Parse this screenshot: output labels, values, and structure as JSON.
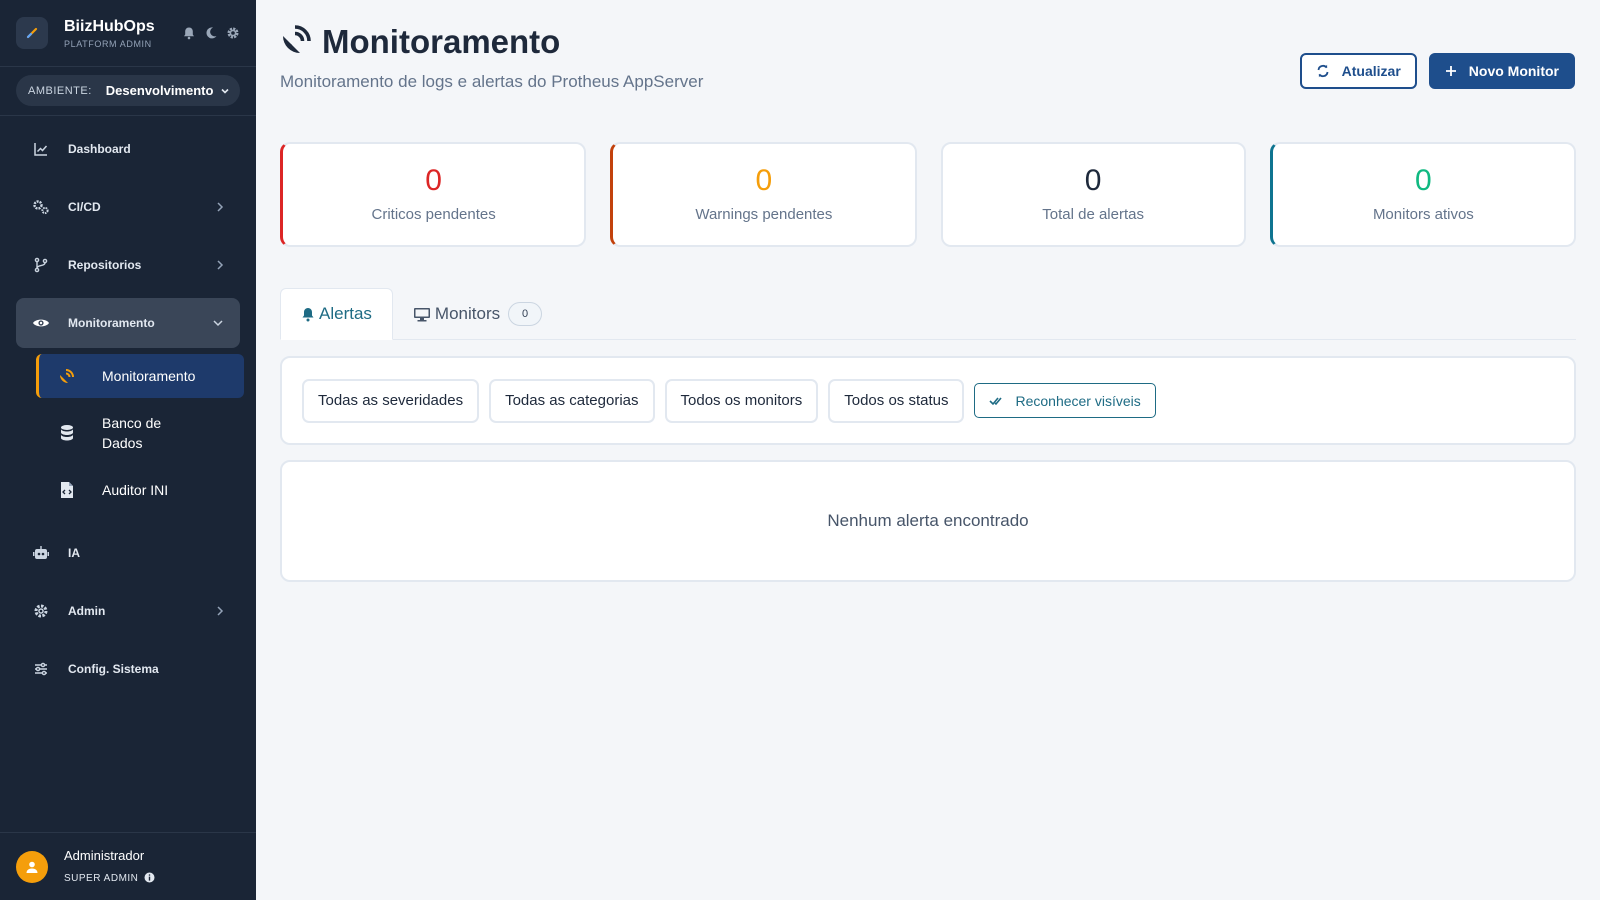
{
  "app": {
    "name": "BiizHubOps",
    "subtitle": "PLATFORM ADMIN"
  },
  "environment": {
    "label": "AMBIENTE:",
    "value": "Desenvolvimento"
  },
  "sidebar": {
    "items": [
      {
        "label": "Dashboard",
        "icon": "chart-line-icon"
      },
      {
        "label": "CI/CD",
        "icon": "cogs-icon"
      },
      {
        "label": "Repositorios",
        "icon": "branch-icon"
      },
      {
        "label": "Monitoramento",
        "icon": "eye-icon"
      },
      {
        "label": "IA",
        "icon": "robot-icon"
      },
      {
        "label": "Admin",
        "icon": "gear-icon"
      },
      {
        "label": "Config. Sistema",
        "icon": "sliders-icon"
      }
    ],
    "subitems": [
      {
        "label": "Monitoramento",
        "icon": "satellite-dish-icon"
      },
      {
        "label": "Banco de Dados",
        "icon": "database-icon"
      },
      {
        "label": "Auditor INI",
        "icon": "file-code-icon"
      }
    ]
  },
  "user": {
    "name": "Administrador",
    "role": "SUPER ADMIN"
  },
  "page": {
    "title": "Monitoramento",
    "subtitle": "Monitoramento de logs e alertas do Protheus AppServer",
    "refresh_label": "Atualizar",
    "new_label": "Novo Monitor"
  },
  "stats": [
    {
      "value": "0",
      "label": "Criticos pendentes"
    },
    {
      "value": "0",
      "label": "Warnings pendentes"
    },
    {
      "value": "0",
      "label": "Total de alertas"
    },
    {
      "value": "0",
      "label": "Monitors ativos"
    }
  ],
  "tabs": {
    "alerts": "Alertas",
    "monitors": "Monitors",
    "monitors_count": "0"
  },
  "filters": {
    "severity": "Todas as severidades",
    "category": "Todas as categorias",
    "monitor": "Todos os monitors",
    "status": "Todos os status",
    "acknowledge": "Reconhecer visíveis"
  },
  "empty_message": "Nenhum alerta encontrado",
  "colors": {
    "sidebar_bg": "#1a2536",
    "primary": "#1e4e8c",
    "accent": "#f59e0b",
    "critical": "#dc2626",
    "warning": "#f59e0b",
    "active": "#10b981",
    "teal": "#1e6b84"
  }
}
